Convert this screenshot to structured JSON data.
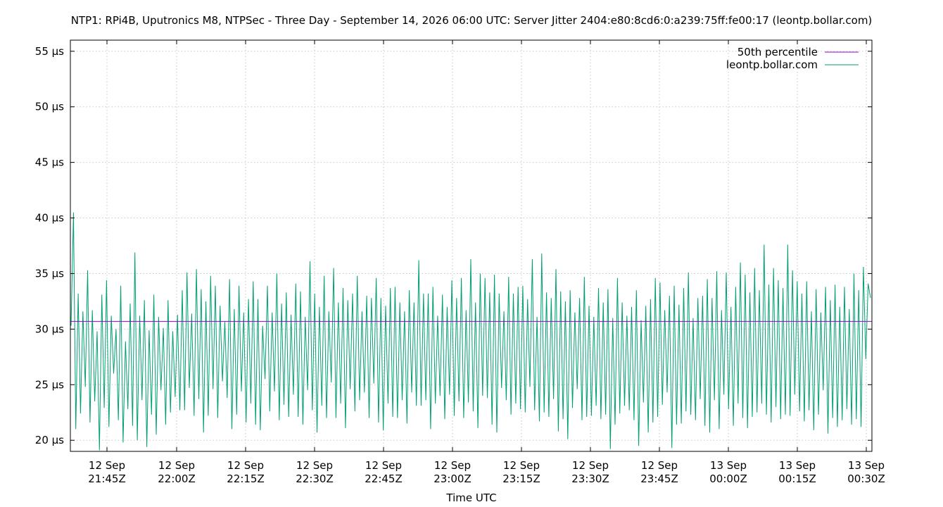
{
  "chart_data": {
    "type": "line",
    "title": "NTP1: RPi4B, Uputronics M8, NTPSec - Three Day - September 14, 2026 06:00 UTC: Server Jitter 2404:e80:8cd6:0:a239:75ff:fe00:17 (leontp.bollar.com)",
    "xlabel": "Time UTC",
    "ylabel": "",
    "x_range_minutes": [
      -49,
      291
    ],
    "ylim": [
      19,
      56
    ],
    "y_unit": "µs",
    "y_ticks": [
      {
        "value": 20,
        "label": "20 µs"
      },
      {
        "value": 25,
        "label": "25 µs"
      },
      {
        "value": 30,
        "label": "30 µs"
      },
      {
        "value": 35,
        "label": "35 µs"
      },
      {
        "value": 40,
        "label": "40 µs"
      },
      {
        "value": 45,
        "label": "45 µs"
      },
      {
        "value": 50,
        "label": "50 µs"
      },
      {
        "value": 55,
        "label": "55 µs"
      }
    ],
    "x_ticks": [
      {
        "minutes": 0,
        "label_day": "12 Sep",
        "label_time": "21:45Z"
      },
      {
        "minutes": 45,
        "label_day": "12 Sep",
        "label_time": "22:00Z"
      },
      {
        "minutes": 75,
        "label_day": "12 Sep",
        "label_time": "22:15Z"
      },
      {
        "minutes": 105,
        "label_day": "12 Sep",
        "label_time": "22:30Z"
      },
      {
        "minutes": 135,
        "label_day": "12 Sep",
        "label_time": "22:45Z"
      },
      {
        "minutes": 165,
        "label_day": "12 Sep",
        "label_time": "23:00Z"
      },
      {
        "minutes": 195,
        "label_day": "12 Sep",
        "label_time": "23:15Z"
      },
      {
        "minutes": 225,
        "label_day": "12 Sep",
        "label_time": "23:30Z"
      },
      {
        "minutes": 255,
        "label_day": "12 Sep",
        "label_time": "23:45Z"
      },
      {
        "minutes": 285,
        "label_day": "13 Sep",
        "label_time": "00:00Z"
      },
      {
        "minutes": 315,
        "label_day": "13 Sep",
        "label_time": "00:15Z"
      },
      {
        "minutes": 345,
        "label_day": "13 Sep",
        "label_time": "00:30Z"
      }
    ],
    "grid": true,
    "legend_position": "top-right",
    "series": [
      {
        "name": "50th percentile",
        "color": "#9400d3",
        "values": [
          30.7,
          30.7
        ]
      },
      {
        "name": "leontp.bollar.com",
        "color": "#009e73",
        "values": [
          30.3,
          40.5,
          21.0,
          33.2,
          22.4,
          31.6,
          24.8,
          35.3,
          21.6,
          31.7,
          23.5,
          29.8,
          19.1,
          33.1,
          22.9,
          34.4,
          21.2,
          31.2,
          26.0,
          30.0,
          21.8,
          33.9,
          19.8,
          28.9,
          22.8,
          32.3,
          21.3,
          36.9,
          20.0,
          31.2,
          23.6,
          32.6,
          19.4,
          29.9,
          22.3,
          33.1,
          20.5,
          31.1,
          24.5,
          30.1,
          21.4,
          32.6,
          22.5,
          29.8,
          23.9,
          31.3,
          22.7,
          33.5,
          22.7,
          35.1,
          24.7,
          31.4,
          22.2,
          35.4,
          23.7,
          33.6,
          20.7,
          32.5,
          22.2,
          34.8,
          24.6,
          33.9,
          22.0,
          32.1,
          25.3,
          30.7,
          23.8,
          34.5,
          21.0,
          31.8,
          22.3,
          33.9,
          24.4,
          31.5,
          21.6,
          32.7,
          23.3,
          34.3,
          21.4,
          32.7,
          20.9,
          30.3,
          25.5,
          33.9,
          22.6,
          31.5,
          24.4,
          35.0,
          21.8,
          32.3,
          23.2,
          33.3,
          22.1,
          31.3,
          24.1,
          34.1,
          22.1,
          33.4,
          21.4,
          31.1,
          24.5,
          36.1,
          22.7,
          33.2,
          20.7,
          32.0,
          23.1,
          34.8,
          22.0,
          31.6,
          25.2,
          35.5,
          22.0,
          32.4,
          23.3,
          33.7,
          21.1,
          32.6,
          24.6,
          33.2,
          22.6,
          34.8,
          23.6,
          31.6,
          24.3,
          33.0,
          22.0,
          32.8,
          25.1,
          34.6,
          21.6,
          32.8,
          20.9,
          32.1,
          23.3,
          33.7,
          22.1,
          33.8,
          22.0,
          32.4,
          23.6,
          31.6,
          21.5,
          33.5,
          24.3,
          32.4,
          23.1,
          36.2,
          23.1,
          33.2,
          23.6,
          33.2,
          21.0,
          33.8,
          23.3,
          31.2,
          24.0,
          33.1,
          21.9,
          32.0,
          24.1,
          34.4,
          22.2,
          32.8,
          23.5,
          34.6,
          22.0,
          31.7,
          23.4,
          36.3,
          22.6,
          32.4,
          21.1,
          35.0,
          24.0,
          34.6,
          23.8,
          33.3,
          21.4,
          34.9,
          20.7,
          33.2,
          24.7,
          31.6,
          23.6,
          34.7,
          22.3,
          33.2,
          23.3,
          33.8,
          22.8,
          33.9,
          22.5,
          32.7,
          24.8,
          36.3,
          22.7,
          31.1,
          21.7,
          36.8,
          22.5,
          33.3,
          22.1,
          32.8,
          23.7,
          35.4,
          20.8,
          33.4,
          21.9,
          32.5,
          20.1,
          33.5,
          22.9,
          31.5,
          24.6,
          32.8,
          21.8,
          34.7,
          22.1,
          32.1,
          22.2,
          31.1,
          23.1,
          33.7,
          21.9,
          32.4,
          22.3,
          33.6,
          19.2,
          31.0,
          21.4,
          34.6,
          22.4,
          32.4,
          23.1,
          31.2,
          22.7,
          32.0,
          21.8,
          33.5,
          19.5,
          30.8,
          23.4,
          32.1,
          20.7,
          32.7,
          21.6,
          34.6,
          22.1,
          34.2,
          23.2,
          31.7,
          24.3,
          33.0,
          19.3,
          33.9,
          21.4,
          32.2,
          21.5,
          33.7,
          22.6,
          35.1,
          22.3,
          31.0,
          21.8,
          32.8,
          23.7,
          33.0,
          21.3,
          34.5,
          20.7,
          32.8,
          23.6,
          35.2,
          21.0,
          31.7,
          24.1,
          35.1,
          22.8,
          32.0,
          21.3,
          33.8,
          23.3,
          36.0,
          22.0,
          34.9,
          21.1,
          33.3,
          22.1,
          35.5,
          22.5,
          33.5,
          23.3,
          37.6,
          22.3,
          34.0,
          21.6,
          35.5,
          23.0,
          34.4,
          21.9,
          33.7,
          22.3,
          37.6,
          22.2,
          35.3,
          24.1,
          34.3,
          22.6,
          33.2,
          21.7,
          34.3,
          22.7,
          31.6,
          20.9,
          33.6,
          22.3,
          31.5,
          24.5,
          33.8,
          20.6,
          32.6,
          22.0,
          34.0,
          21.2,
          32.0,
          21.8,
          33.8,
          22.8,
          31.8,
          21.4,
          35.0,
          21.9,
          33.5,
          21.2,
          35.6,
          27.3,
          34.1,
          32.8
        ]
      }
    ]
  }
}
